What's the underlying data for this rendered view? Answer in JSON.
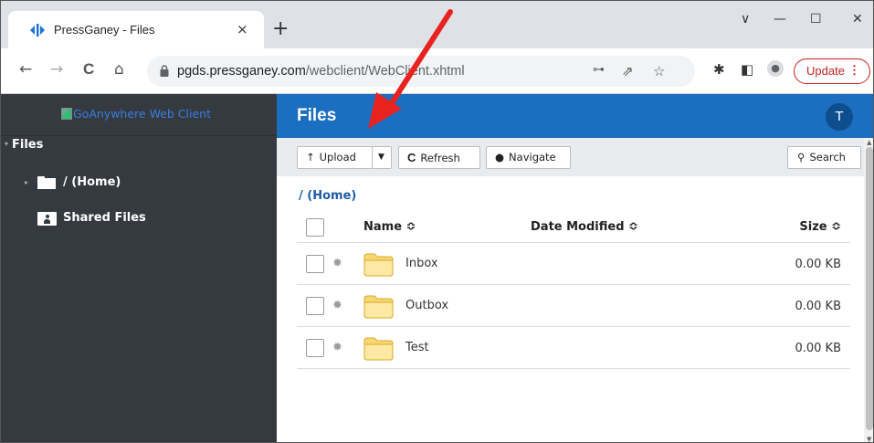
{
  "browser": {
    "tab_title": "PressGaney - Files",
    "tab_close": "×",
    "new_tab": "+",
    "window_controls": {
      "dropdown": "∨",
      "minimize": "—",
      "maximize": "☐",
      "close": "✕"
    },
    "nav": {
      "back": "←",
      "forward": "→",
      "reload": "C",
      "home": "⌂"
    },
    "url_host": "pgds.pressganey.com",
    "url_path": "/webclient/WebClient.xhtml",
    "update_label": "Update",
    "update_menu": "⋮",
    "accent_update": "#c5221f"
  },
  "sidebar": {
    "logo_alt": "GoAnywhere Web Client",
    "section_label": "Files",
    "items": [
      {
        "label": "/ (Home)",
        "icon": "folder-icon"
      },
      {
        "label": "Shared Files",
        "icon": "shared-files-icon"
      }
    ]
  },
  "header": {
    "title": "Files",
    "avatar_initial": "T",
    "color": "#1c6ec0"
  },
  "actions": {
    "upload": "Upload",
    "refresh": "Refresh",
    "navigate": "Navigate",
    "search": "Search"
  },
  "breadcrumb": "/ (Home)",
  "table": {
    "columns": {
      "name": "Name ≎",
      "date": "Date Modified ≎",
      "size": "Size ≎"
    },
    "rows": [
      {
        "name": "Inbox",
        "size": "0.00 KB"
      },
      {
        "name": "Outbox",
        "size": "0.00 KB"
      },
      {
        "name": "Test",
        "size": "0.00 KB"
      }
    ]
  },
  "annotation": {
    "color": "#e8231f"
  }
}
